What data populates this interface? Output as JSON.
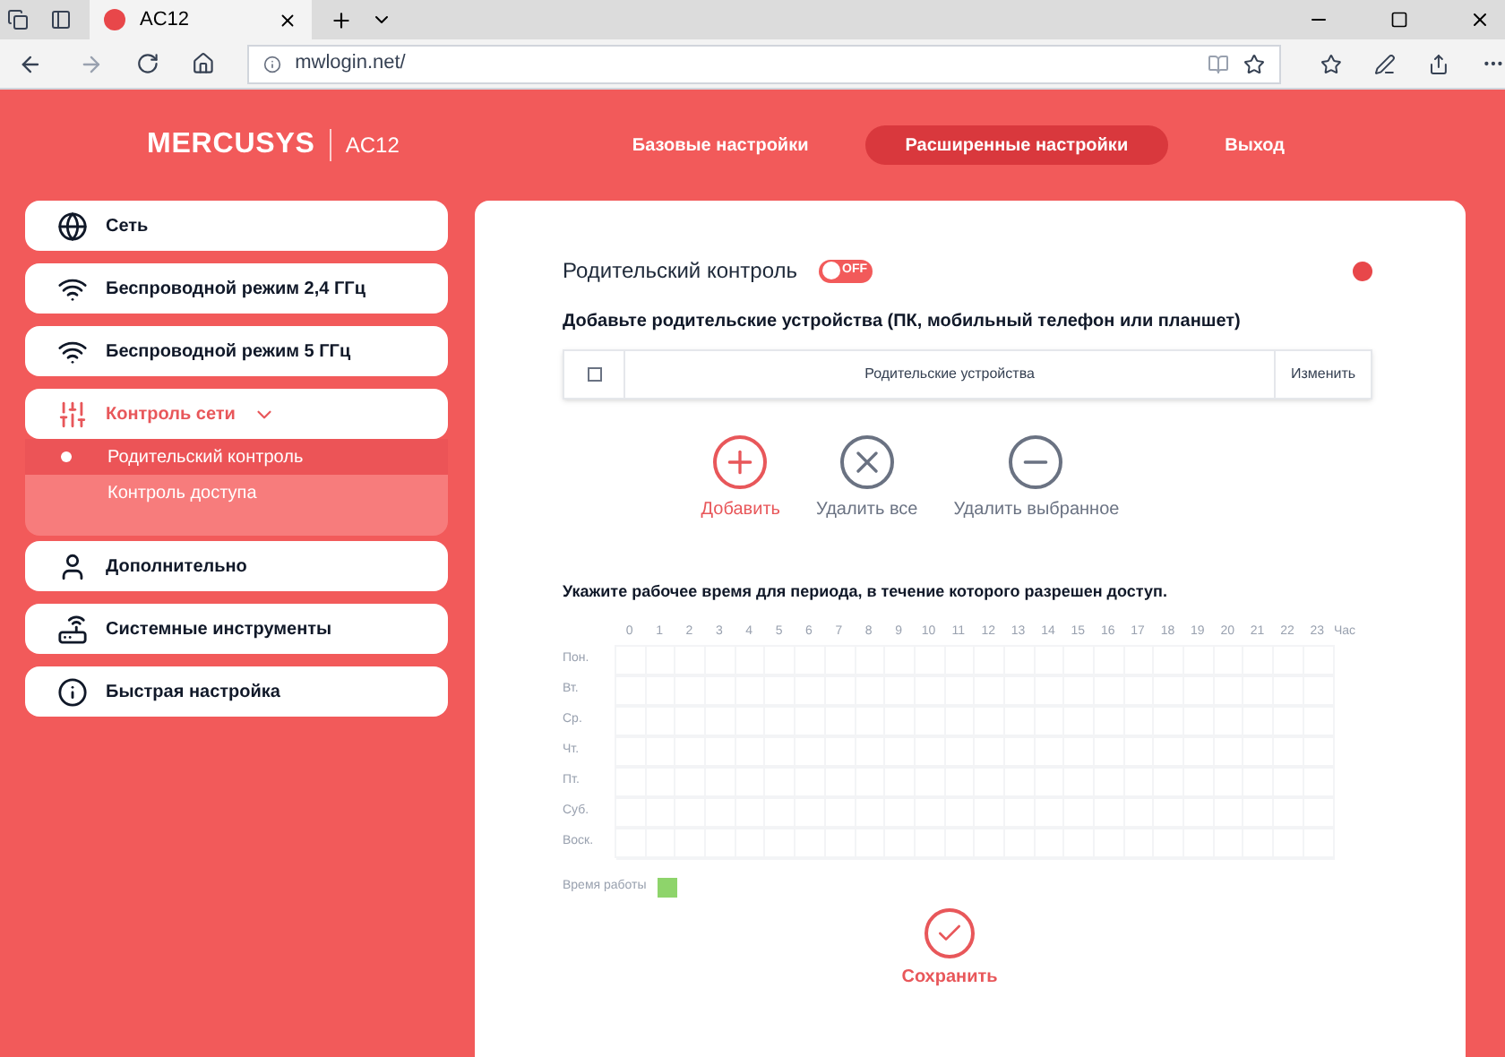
{
  "browser": {
    "tab_title": "AC12",
    "url": "mwlogin.net/"
  },
  "header": {
    "brand": "MERCUSYS",
    "model": "AC12",
    "nav": [
      {
        "label": "Базовые настройки",
        "selected": false
      },
      {
        "label": "Расширенные настройки",
        "selected": true
      },
      {
        "label": "Выход",
        "selected": false
      }
    ]
  },
  "sidebar": {
    "items": [
      {
        "kind": "globe",
        "label": "Сеть",
        "expanded": false
      },
      {
        "kind": "wifi",
        "label": "Беспроводной режим 2,4 ГГц",
        "expanded": false
      },
      {
        "kind": "wifi",
        "label": "Беспроводной режим 5 ГГц",
        "expanded": false
      },
      {
        "kind": "sliders",
        "label": "Контроль сети",
        "expanded": true,
        "children": [
          {
            "label": "Родительский контроль",
            "selected": true
          },
          {
            "label": "Контроль доступа",
            "selected": false
          }
        ]
      },
      {
        "kind": "person",
        "label": "Дополнительно",
        "expanded": false
      },
      {
        "kind": "router",
        "label": "Системные инструменты",
        "expanded": false
      },
      {
        "kind": "info",
        "label": "Быстрая настройка",
        "expanded": false
      }
    ]
  },
  "parental": {
    "title": "Родительский контроль",
    "toggle": {
      "on": false,
      "label": "OFF"
    },
    "devices_heading": "Добавьте родительские устройства (ПК, мобильный телефон или планшет)",
    "table": {
      "checked": false,
      "columns": [
        "Родительские устройства",
        "Изменить"
      ]
    },
    "actions": [
      {
        "kind": "add",
        "label": "Добавить",
        "disabled": false
      },
      {
        "kind": "remove_all",
        "label": "Удалить все",
        "disabled": true
      },
      {
        "kind": "remove_selected",
        "label": "Удалить выбранное",
        "disabled": true
      }
    ],
    "schedule_heading": "Укажите рабочее время для периода, в течение которого разрешен доступ.",
    "hours": [
      "0",
      "1",
      "2",
      "3",
      "4",
      "5",
      "6",
      "7",
      "8",
      "9",
      "10",
      "11",
      "12",
      "13",
      "14",
      "15",
      "16",
      "17",
      "18",
      "19",
      "20",
      "21",
      "22",
      "23"
    ],
    "hour_unit": "Час",
    "days": [
      "Пон.",
      "Вт.",
      "Ср.",
      "Чт.",
      "Пт.",
      "Суб.",
      "Воск."
    ],
    "legend": {
      "label": "Время работы",
      "color": "#8ed46b"
    },
    "save": "Сохранить"
  }
}
